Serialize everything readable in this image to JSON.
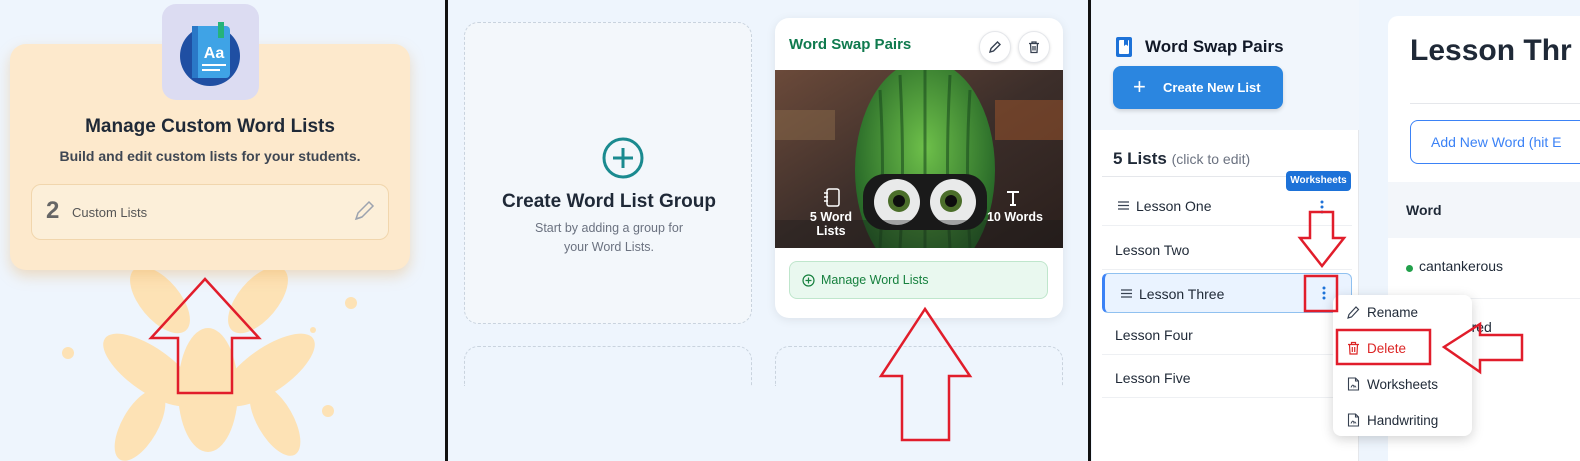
{
  "panel1": {
    "title": "Manage Custom Word Lists",
    "subtitle": "Build and edit custom lists for your students.",
    "count": "2",
    "count_label": "Custom Lists",
    "book_icon_letters": "Aa",
    "colors": {
      "card": "#fde9cc",
      "flower": "#fde2b5"
    }
  },
  "panel2": {
    "create_title": "Create Word List Group",
    "create_subtitle": "Start by adding a group for your Word Lists.",
    "group_title": "Word Swap Pairs",
    "word_lists": "5 Word Lists",
    "words": "10 Words",
    "manage_button": "Manage Word Lists",
    "colors": {
      "title": "#0f7a4e",
      "manage_bg": "#e9f8ef"
    }
  },
  "panel3": {
    "app_title": "Word Swap Pairs",
    "create_list_button": "Create New List",
    "lists_count": "5 Lists",
    "lists_hint": "(click to edit)",
    "worksheets_badge": "Worksheets",
    "lists": [
      "Lesson One",
      "Lesson Two",
      "Lesson Three",
      "Lesson Four",
      "Lesson Five"
    ],
    "selected_list": "Lesson Three",
    "menu": {
      "rename": "Rename",
      "delete": "Delete",
      "worksheets": "Worksheets",
      "handwriting": "Handwriting"
    },
    "main_title": "Lesson Thr",
    "add_word_button": "Add New Word (hit E",
    "table_header": "Word",
    "words": [
      "cantankerous",
      "pered"
    ],
    "colors": {
      "primary": "#2b86e0",
      "delete": "#dc2626",
      "highlight": "#e11d2b"
    }
  }
}
